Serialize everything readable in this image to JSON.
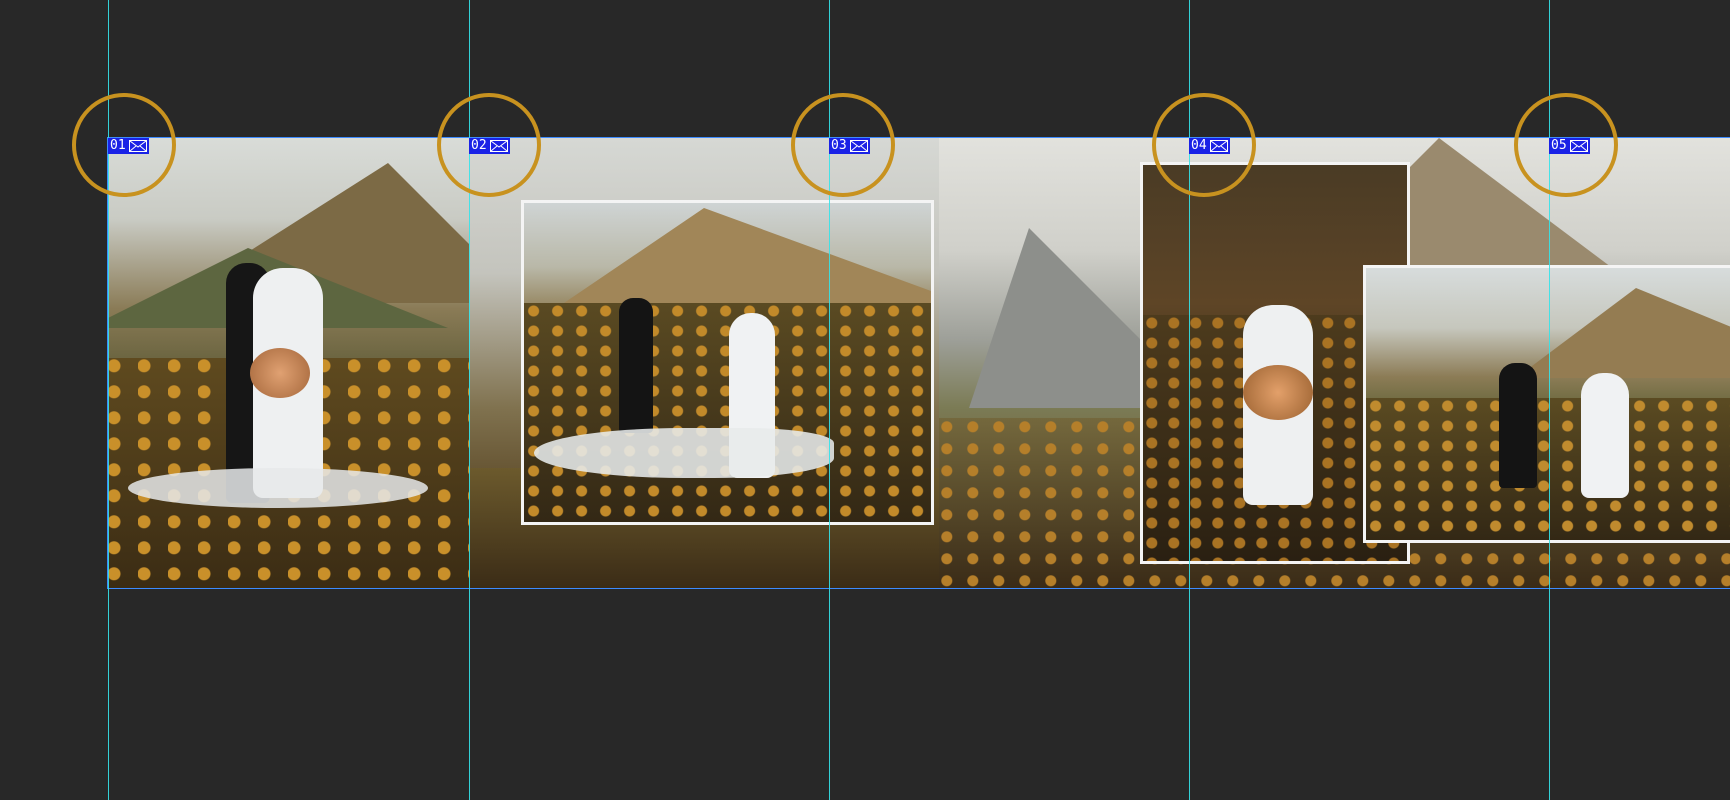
{
  "colors": {
    "background": "#282828",
    "guide": "#34e3ea",
    "label_bg": "#1a22e6",
    "ring": "#c8921f",
    "frame": "#f4f4f4"
  },
  "spreads": [
    {
      "number": "01",
      "icon": "image-icon"
    },
    {
      "number": "02",
      "icon": "image-icon"
    },
    {
      "number": "03",
      "icon": "image-icon"
    },
    {
      "number": "04",
      "icon": "image-icon"
    },
    {
      "number": "05",
      "icon": "image-icon"
    }
  ]
}
